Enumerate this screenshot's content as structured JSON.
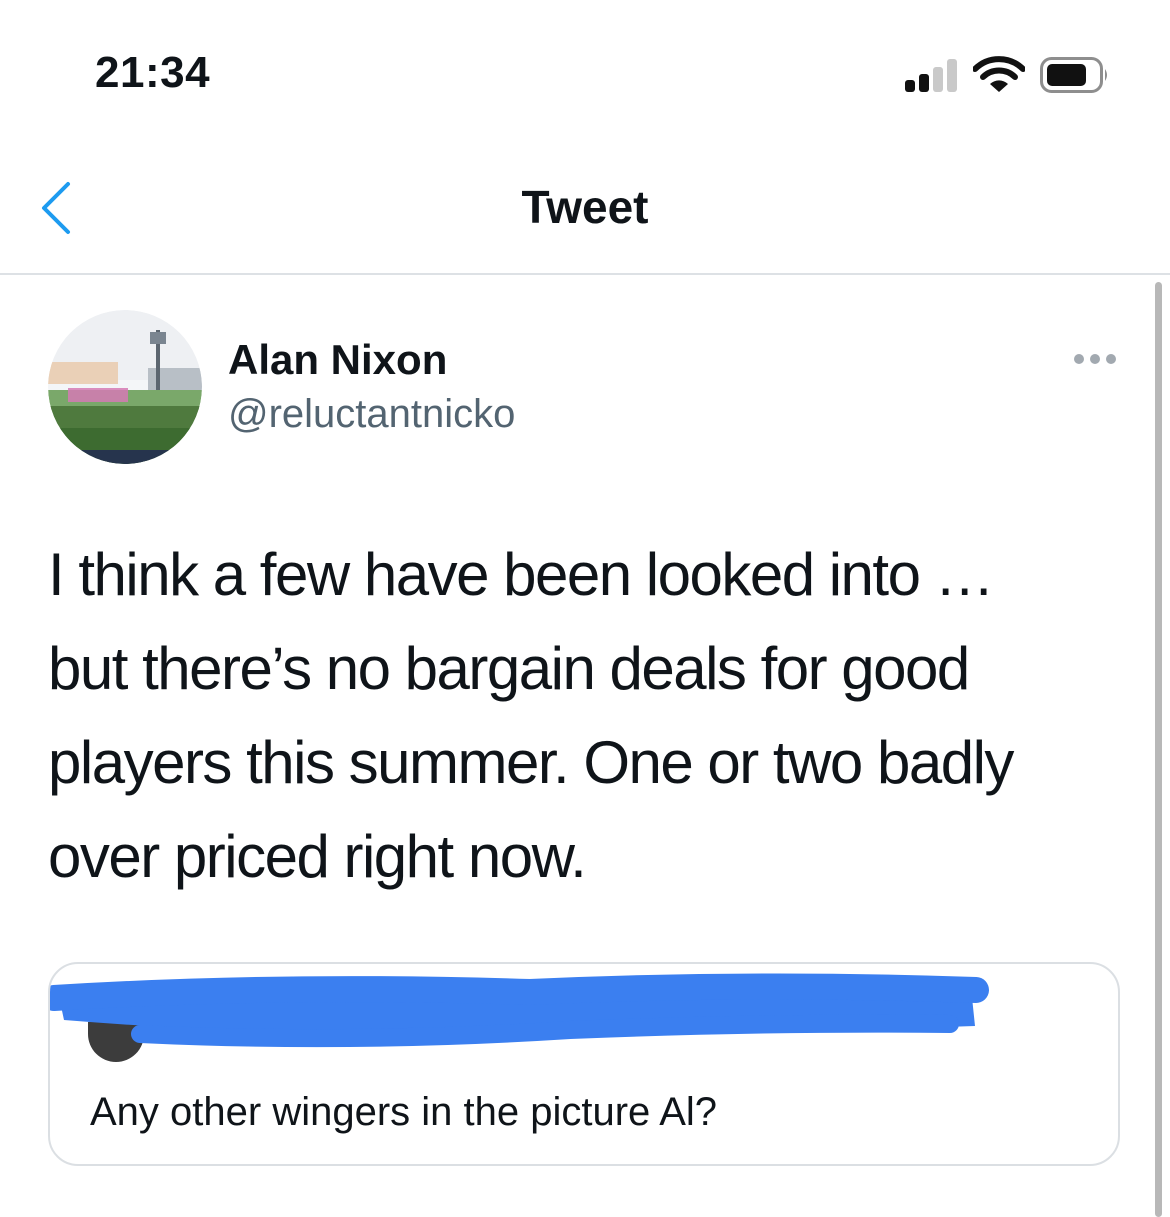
{
  "status_bar": {
    "time": "21:34"
  },
  "nav": {
    "title": "Tweet",
    "back_icon": "chevron-left-icon"
  },
  "tweet": {
    "author_name": "Alan Nixon",
    "author_handle": "@reluctantnicko",
    "more_icon": "more-horizontal-icon",
    "lines": [
      "I think a few have been looked into …",
      "but there’s no bargain deals for good",
      "players this summer. One or two badly",
      "over priced right now."
    ]
  },
  "quote": {
    "text": "Any other wingers in the picture Al?"
  },
  "colors": {
    "accent": "#1d9bf0",
    "redaction": "#3b7ff0",
    "secondary_text": "#536471"
  }
}
